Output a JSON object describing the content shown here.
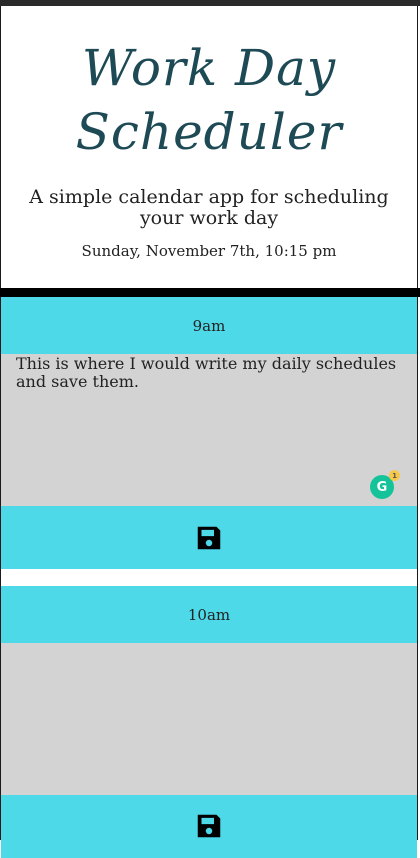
{
  "header": {
    "title": "Work Day Scheduler",
    "subtitle": "A simple calendar app for scheduling your work day",
    "current_date": "Sunday, November 7th, 10:15 pm"
  },
  "time_blocks": [
    {
      "hour": "9am",
      "text": "This is where I would write my daily schedules and save them."
    },
    {
      "hour": "10am",
      "text": ""
    }
  ],
  "grammarly": {
    "letter": "G",
    "badge_count": "1"
  },
  "icons": {
    "save": "floppy-disk-save-icon"
  },
  "colors": {
    "accent": "#4dd9e8",
    "textarea_bg": "#d3d3d3",
    "title": "#1e4a55",
    "grammarly": "#15c39a"
  }
}
